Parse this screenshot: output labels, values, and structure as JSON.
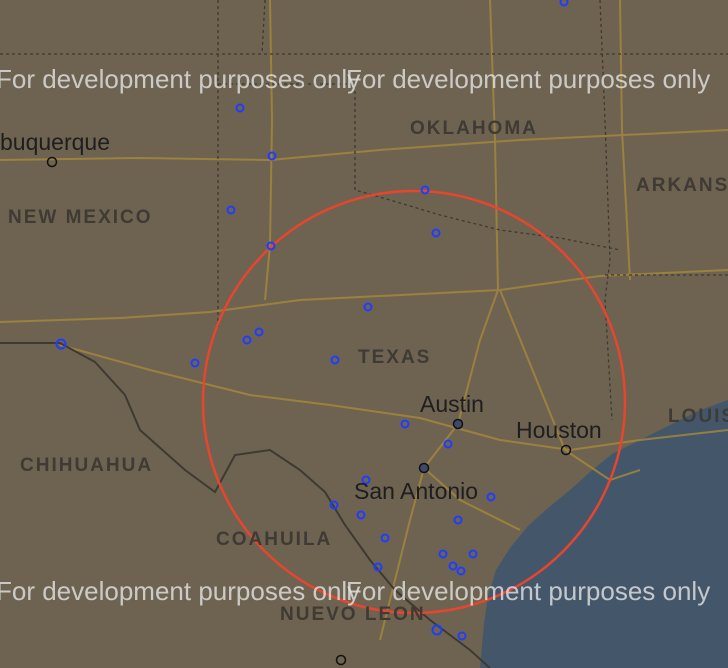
{
  "watermark": "For development purposes only",
  "regions": {
    "oklahoma": "OKLAHOMA",
    "arkansas": "ARKANS",
    "new_mexico": "NEW MEXICO",
    "texas": "TEXAS",
    "louisiana": "LOUIS",
    "chihuahua": "CHIHUAHUA",
    "coahuila": "COAHUILA",
    "nuevo_leon": "NUEVO LEON"
  },
  "cities": {
    "albuquerque": "buquerque",
    "austin": "Austin",
    "houston": "Houston",
    "san_antonio": "San Antonio"
  },
  "colors": {
    "land": "#6d6350",
    "water": "#44576a",
    "roads": "#a8893a",
    "borders": "#3e3a32",
    "circle": "#e8452e",
    "markers": "#1f3dff"
  }
}
